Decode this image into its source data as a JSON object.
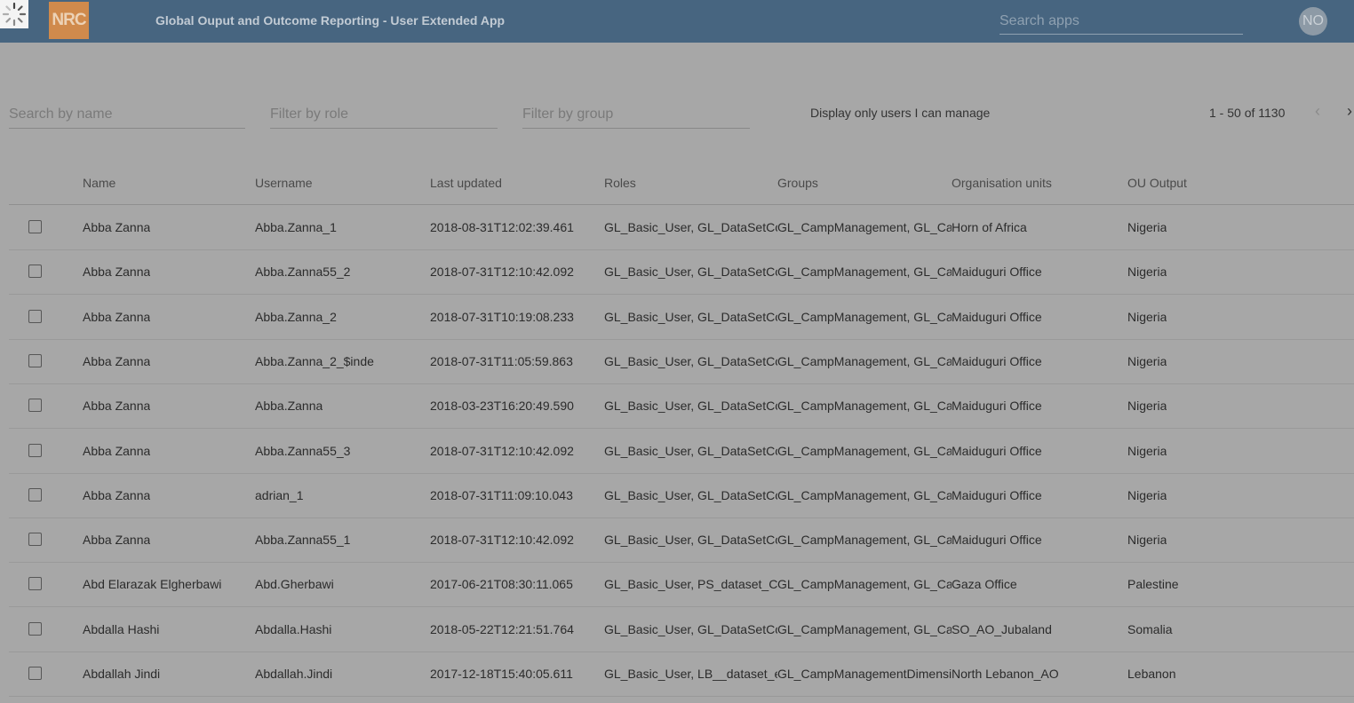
{
  "header": {
    "logo_text": "NRC",
    "title": "Global Ouput and Outcome Reporting - User Extended App",
    "search_placeholder": "Search apps",
    "avatar_initials": "NO"
  },
  "filters": {
    "name_placeholder": "Search by name",
    "role_placeholder": "Filter by role",
    "group_placeholder": "Filter by group",
    "manage_label": "Display only users I can manage"
  },
  "pagination": {
    "text": "1 - 50 of 1130",
    "prev_icon": "‹",
    "next_icon": "›"
  },
  "table": {
    "columns": [
      "Name",
      "Username",
      "Last updated",
      "Roles",
      "Groups",
      "Organisation units",
      "OU Output"
    ],
    "rows": [
      {
        "name": "Abba Zanna",
        "username": "Abba.Zanna_1",
        "updated": "2018-08-31T12:02:39.461",
        "roles": "GL_Basic_User, GL_DataSetCon",
        "groups": "GL_CampManagement, GL_Can",
        "org": "Horn of Africa",
        "ou": "Nigeria"
      },
      {
        "name": "Abba Zanna",
        "username": "Abba.Zanna55_2",
        "updated": "2018-07-31T12:10:42.092",
        "roles": "GL_Basic_User, GL_DataSetCon",
        "groups": "GL_CampManagement, GL_Can",
        "org": "Maiduguri Office",
        "ou": "Nigeria"
      },
      {
        "name": "Abba Zanna",
        "username": "Abba.Zanna_2",
        "updated": "2018-07-31T10:19:08.233",
        "roles": "GL_Basic_User, GL_DataSetCon",
        "groups": "GL_CampManagement, GL_Can",
        "org": "Maiduguri Office",
        "ou": "Nigeria"
      },
      {
        "name": "Abba Zanna",
        "username": "Abba.Zanna_2_$inde",
        "updated": "2018-07-31T11:05:59.863",
        "roles": "GL_Basic_User, GL_DataSetCon",
        "groups": "GL_CampManagement, GL_Can",
        "org": "Maiduguri Office",
        "ou": "Nigeria"
      },
      {
        "name": "Abba Zanna",
        "username": "Abba.Zanna",
        "updated": "2018-03-23T16:20:49.590",
        "roles": "GL_Basic_User, GL_DataSetCon",
        "groups": "GL_CampManagement, GL_Can",
        "org": "Maiduguri Office",
        "ou": "Nigeria"
      },
      {
        "name": "Abba Zanna",
        "username": "Abba.Zanna55_3",
        "updated": "2018-07-31T12:10:42.092",
        "roles": "GL_Basic_User, GL_DataSetCon",
        "groups": "GL_CampManagement, GL_Can",
        "org": "Maiduguri Office",
        "ou": "Nigeria"
      },
      {
        "name": "Abba Zanna",
        "username": "adrian_1",
        "updated": "2018-07-31T11:09:10.043",
        "roles": "GL_Basic_User, GL_DataSetCon",
        "groups": "GL_CampManagement, GL_Can",
        "org": "Maiduguri Office",
        "ou": "Nigeria"
      },
      {
        "name": "Abba Zanna",
        "username": "Abba.Zanna55_1",
        "updated": "2018-07-31T12:10:42.092",
        "roles": "GL_Basic_User, GL_DataSetCon",
        "groups": "GL_CampManagement, GL_Can",
        "org": "Maiduguri Office",
        "ou": "Nigeria"
      },
      {
        "name": "Abd Elarazak Elgherbawi",
        "username": "Abd.Gherbawi",
        "updated": "2017-06-21T08:30:11.065",
        "roles": "GL_Basic_User, PS_dataset_CM",
        "groups": "GL_CampManagement, GL_Can",
        "org": "Gaza Office",
        "ou": "Palestine"
      },
      {
        "name": "Abdalla Hashi",
        "username": "Abdalla.Hashi",
        "updated": "2018-05-22T12:21:51.764",
        "roles": "GL_Basic_User, GL_DataSetCon",
        "groups": "GL_CampManagement, GL_Can",
        "org": "SO_AO_Jubaland",
        "ou": "Somalia"
      },
      {
        "name": "Abdallah Jindi",
        "username": "Abdallah.Jindi",
        "updated": "2017-12-18T15:40:05.611",
        "roles": "GL_Basic_User, LB__dataset_ed",
        "groups": "GL_CampManagementDimensi",
        "org": "North Lebanon_AO",
        "ou": "Lebanon"
      }
    ]
  }
}
